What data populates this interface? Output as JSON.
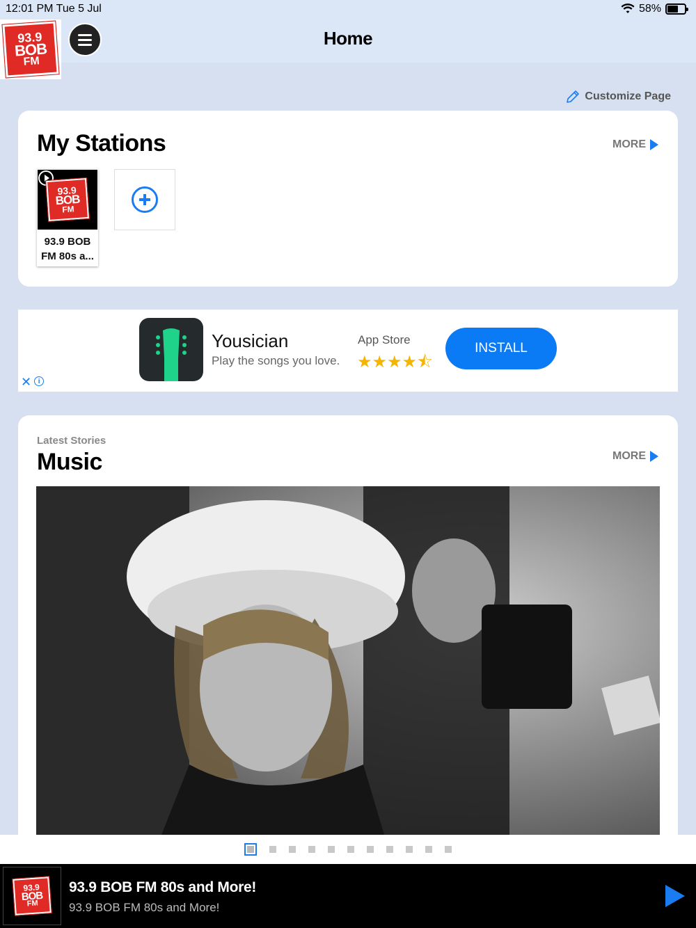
{
  "status_bar": {
    "time_date": "12:01 PM   Tue 5 Jul",
    "battery": "58%"
  },
  "header": {
    "title": "Home"
  },
  "logo": {
    "line1": "93.9",
    "line2": "BOB",
    "line3": "FM"
  },
  "customize_label": "Customize Page",
  "my_stations": {
    "title": "My Stations",
    "more_label": "MORE",
    "stations": [
      {
        "name": "93.9 BOB FM 80s a..."
      }
    ]
  },
  "ad": {
    "app_name": "Yousician",
    "tagline": "Play the songs you love.",
    "store": "App Store",
    "rating_stars": "★★★★⯪",
    "install_label": "INSTALL",
    "close_symbol": "✕",
    "info_symbol": "i"
  },
  "stories": {
    "subtitle": "Latest Stories",
    "title": "Music",
    "more_label": "MORE",
    "page_count": 11,
    "active_page": 1
  },
  "player": {
    "title": "93.9 BOB FM 80s and More!",
    "subtitle": "93.9 BOB FM 80s and More!"
  },
  "colors": {
    "accent": "#1a7cf0",
    "logo_red": "#e02a26",
    "install_blue": "#0b7bf5"
  }
}
